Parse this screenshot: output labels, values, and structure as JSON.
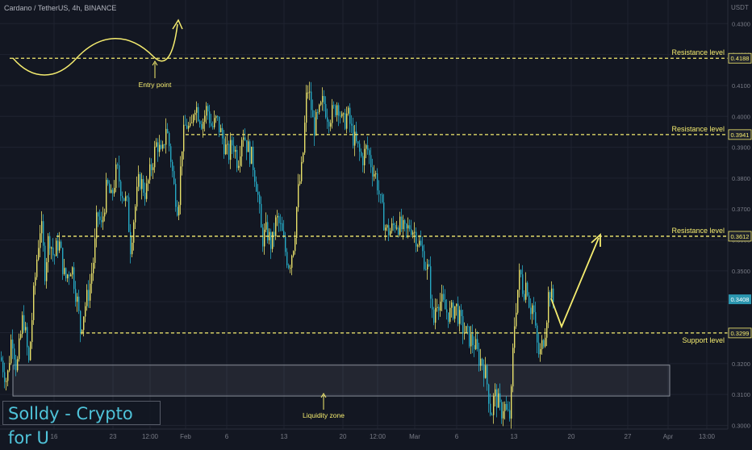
{
  "header": {
    "symbol_title": "Cardano / TetherUS, 4h, BINANCE",
    "currency": "USDT"
  },
  "branding": {
    "text": "Solldy - Crypto for U"
  },
  "colors": {
    "background": "#131722",
    "grid": "#1f2330",
    "axis_text": "#787b86",
    "candle_up": "#e8e06a",
    "candle_down": "#26a9c4",
    "annotation": "#f5ec6f",
    "zone_border": "#8a8f99",
    "current_price_bg": "#2b97b0"
  },
  "chart_data": {
    "type": "candlestick",
    "title": "Cardano / TetherUS, 4h, BINANCE",
    "ylabel": "USDT",
    "ylim": [
      0.2975,
      0.4345
    ],
    "y_ticks": [
      "0.4300",
      "0.4200",
      "0.4100",
      "0.4000",
      "0.3900",
      "0.3800",
      "0.3700",
      "0.3600",
      "0.3500",
      "0.3400",
      "0.3300",
      "0.3200",
      "0.3100",
      "0.3000"
    ],
    "x_ticks": [
      "16",
      "23",
      "12:00",
      "Feb",
      "6",
      "13",
      "20",
      "12:00",
      "Mar",
      "6",
      "13",
      "20",
      "27",
      "Apr",
      "13:00"
    ],
    "grid": true,
    "close_path": [
      [
        0,
        0.322
      ],
      [
        8,
        0.314
      ],
      [
        14,
        0.33
      ],
      [
        20,
        0.318
      ],
      [
        28,
        0.336
      ],
      [
        35,
        0.32
      ],
      [
        41,
        0.342
      ],
      [
        46,
        0.357
      ],
      [
        50,
        0.366
      ],
      [
        55,
        0.35
      ],
      [
        60,
        0.362
      ],
      [
        66,
        0.354
      ],
      [
        72,
        0.36
      ],
      [
        80,
        0.347
      ],
      [
        88,
        0.352
      ],
      [
        95,
        0.34
      ],
      [
        99,
        0.331
      ],
      [
        104,
        0.338
      ],
      [
        110,
        0.344
      ],
      [
        116,
        0.355
      ],
      [
        120,
        0.369
      ],
      [
        125,
        0.364
      ],
      [
        132,
        0.378
      ],
      [
        137,
        0.373
      ],
      [
        144,
        0.383
      ],
      [
        150,
        0.376
      ],
      [
        157,
        0.371
      ],
      [
        161,
        0.358
      ],
      [
        166,
        0.369
      ],
      [
        172,
        0.38
      ],
      [
        180,
        0.375
      ],
      [
        188,
        0.385
      ],
      [
        194,
        0.392
      ],
      [
        200,
        0.386
      ],
      [
        205,
        0.397
      ],
      [
        210,
        0.389
      ],
      [
        215,
        0.377
      ],
      [
        220,
        0.37
      ],
      [
        225,
        0.391
      ],
      [
        230,
        0.398
      ],
      [
        236,
        0.394
      ],
      [
        240,
        0.405
      ],
      [
        244,
        0.402
      ],
      [
        250,
        0.398
      ],
      [
        256,
        0.403
      ],
      [
        262,
        0.396
      ],
      [
        268,
        0.399
      ],
      [
        276,
        0.392
      ],
      [
        282,
        0.387
      ],
      [
        288,
        0.392
      ],
      [
        294,
        0.385
      ],
      [
        300,
        0.396
      ],
      [
        306,
        0.39
      ],
      [
        312,
        0.386
      ],
      [
        318,
        0.377
      ],
      [
        324,
        0.36
      ],
      [
        330,
        0.363
      ],
      [
        336,
        0.358
      ],
      [
        342,
        0.367
      ],
      [
        348,
        0.363
      ],
      [
        354,
        0.355
      ],
      [
        358,
        0.352
      ],
      [
        364,
        0.36
      ],
      [
        368,
        0.374
      ],
      [
        374,
        0.384
      ],
      [
        380,
        0.41
      ],
      [
        384,
        0.405
      ],
      [
        388,
        0.396
      ],
      [
        394,
        0.4
      ],
      [
        400,
        0.405
      ],
      [
        406,
        0.4
      ],
      [
        412,
        0.401
      ],
      [
        418,
        0.405
      ],
      [
        424,
        0.397
      ],
      [
        430,
        0.401
      ],
      [
        436,
        0.394
      ],
      [
        442,
        0.39
      ],
      [
        448,
        0.386
      ],
      [
        454,
        0.39
      ],
      [
        460,
        0.384
      ],
      [
        466,
        0.38
      ],
      [
        472,
        0.37
      ],
      [
        478,
        0.363
      ],
      [
        484,
        0.363
      ],
      [
        490,
        0.366
      ],
      [
        496,
        0.364
      ],
      [
        502,
        0.362
      ],
      [
        508,
        0.365
      ],
      [
        514,
        0.362
      ],
      [
        520,
        0.358
      ],
      [
        526,
        0.353
      ],
      [
        532,
        0.348
      ],
      [
        536,
        0.331
      ],
      [
        540,
        0.341
      ],
      [
        546,
        0.34
      ],
      [
        552,
        0.337
      ],
      [
        558,
        0.336
      ],
      [
        564,
        0.339
      ],
      [
        570,
        0.333
      ],
      [
        576,
        0.33
      ],
      [
        582,
        0.328
      ],
      [
        588,
        0.326
      ],
      [
        592,
        0.322
      ],
      [
        596,
        0.321
      ],
      [
        600,
        0.318
      ],
      [
        604,
        0.312
      ],
      [
        608,
        0.303
      ],
      [
        612,
        0.31
      ],
      [
        616,
        0.308
      ],
      [
        620,
        0.304
      ],
      [
        624,
        0.307
      ],
      [
        628,
        0.303
      ],
      [
        632,
        0.303
      ],
      [
        636,
        0.33
      ],
      [
        640,
        0.342
      ],
      [
        644,
        0.35
      ],
      [
        648,
        0.343
      ],
      [
        652,
        0.347
      ],
      [
        656,
        0.338
      ],
      [
        660,
        0.339
      ],
      [
        664,
        0.327
      ],
      [
        668,
        0.322
      ],
      [
        672,
        0.327
      ],
      [
        676,
        0.333
      ],
      [
        680,
        0.345
      ],
      [
        684,
        0.34
      ]
    ],
    "last_price": "0.3408",
    "levels": [
      {
        "label": "Resistance level",
        "price_label": "0.4188",
        "value": 0.4188
      },
      {
        "label": "Resistance level",
        "price_label": "0.3941",
        "value": 0.3941
      },
      {
        "label": "Resistance level",
        "price_label": "0.3612",
        "value": 0.3612
      },
      {
        "label": "Support level",
        "price_label": "0.3299",
        "value": 0.3299
      }
    ],
    "zones": [
      {
        "label": "Liquidity zone",
        "from": 0.3095,
        "to": 0.3195
      }
    ],
    "annotations": [
      {
        "label": "Entry point"
      }
    ]
  }
}
